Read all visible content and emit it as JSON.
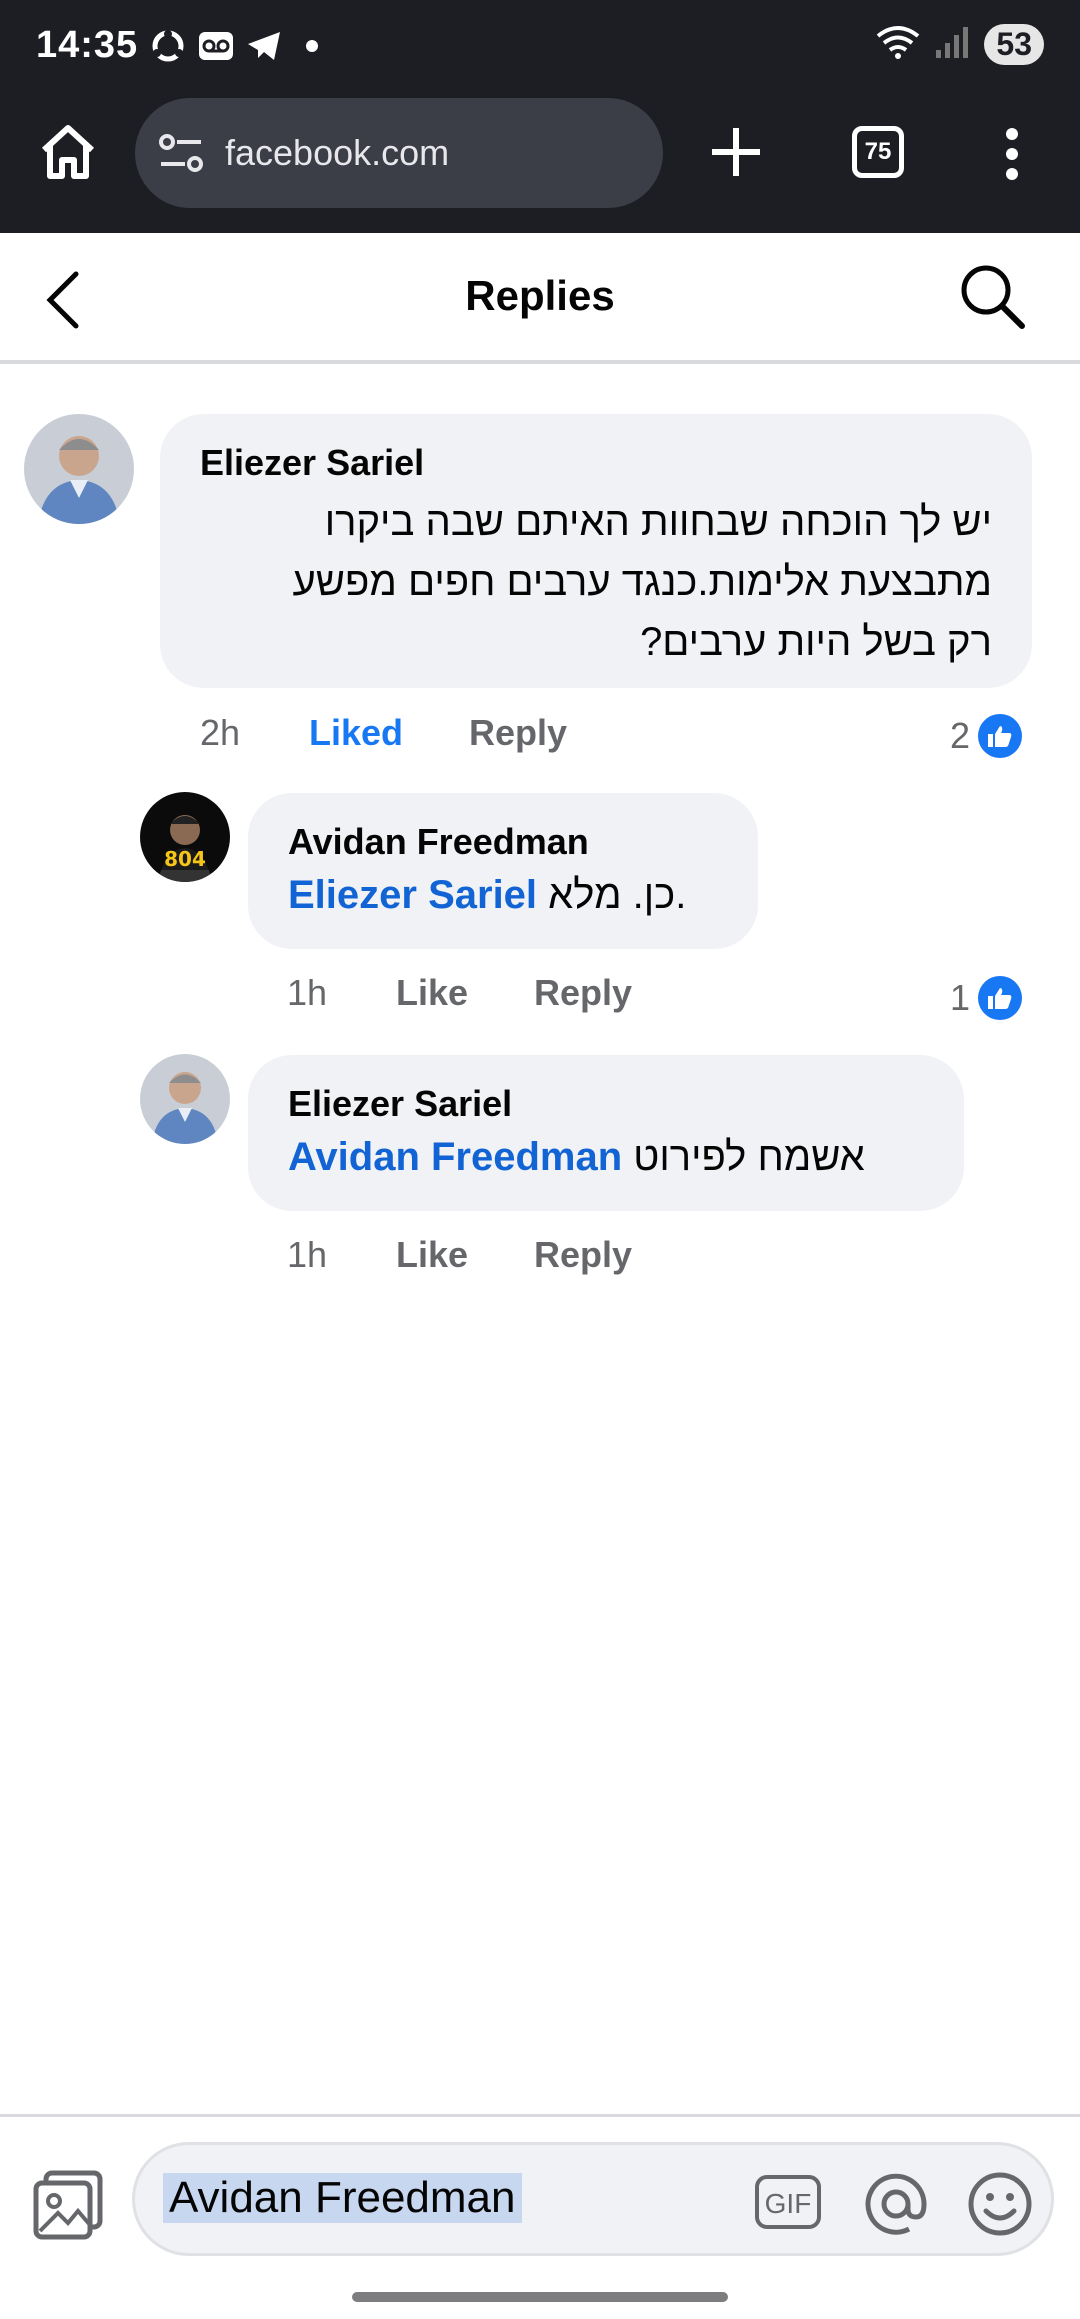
{
  "status_bar": {
    "time": "14:35",
    "battery": "53",
    "icons": [
      "sync-icon",
      "voicemail-icon",
      "telegram-icon",
      "dot-icon",
      "wifi-icon",
      "signal-icon"
    ]
  },
  "browser": {
    "url": "facebook.com",
    "tab_count": "75"
  },
  "header": {
    "title": "Replies"
  },
  "comments": [
    {
      "author": "Eliezer Sariel",
      "text_lines": [
        "יש לך הוכחה שבחוות האיתם שבה ביקרו",
        "מתבצעת אלימות.כנגד ערבים חפים מפשע",
        "רק בשל היות ערבים?"
      ],
      "time": "2h",
      "like_label": "Liked",
      "reply_label": "Reply",
      "reaction_count": "2"
    },
    {
      "author": "Avidan Freedman",
      "mention": "Eliezer Sariel",
      "text": "כן. מלא.",
      "time": "1h",
      "like_label": "Like",
      "reply_label": "Reply",
      "reaction_count": "1",
      "avatar_badge": "804"
    },
    {
      "author": "Eliezer Sariel",
      "mention": "Avidan Freedman",
      "text": "אשמח לפירוט",
      "time": "1h",
      "like_label": "Like",
      "reply_label": "Reply"
    }
  ],
  "composer": {
    "value": "Avidan Freedman",
    "gif_label": "GIF"
  },
  "colors": {
    "accent": "#1877f2",
    "mention": "#1263d4",
    "bubble": "#f0f2f5",
    "chrome": "#1d1e23"
  }
}
